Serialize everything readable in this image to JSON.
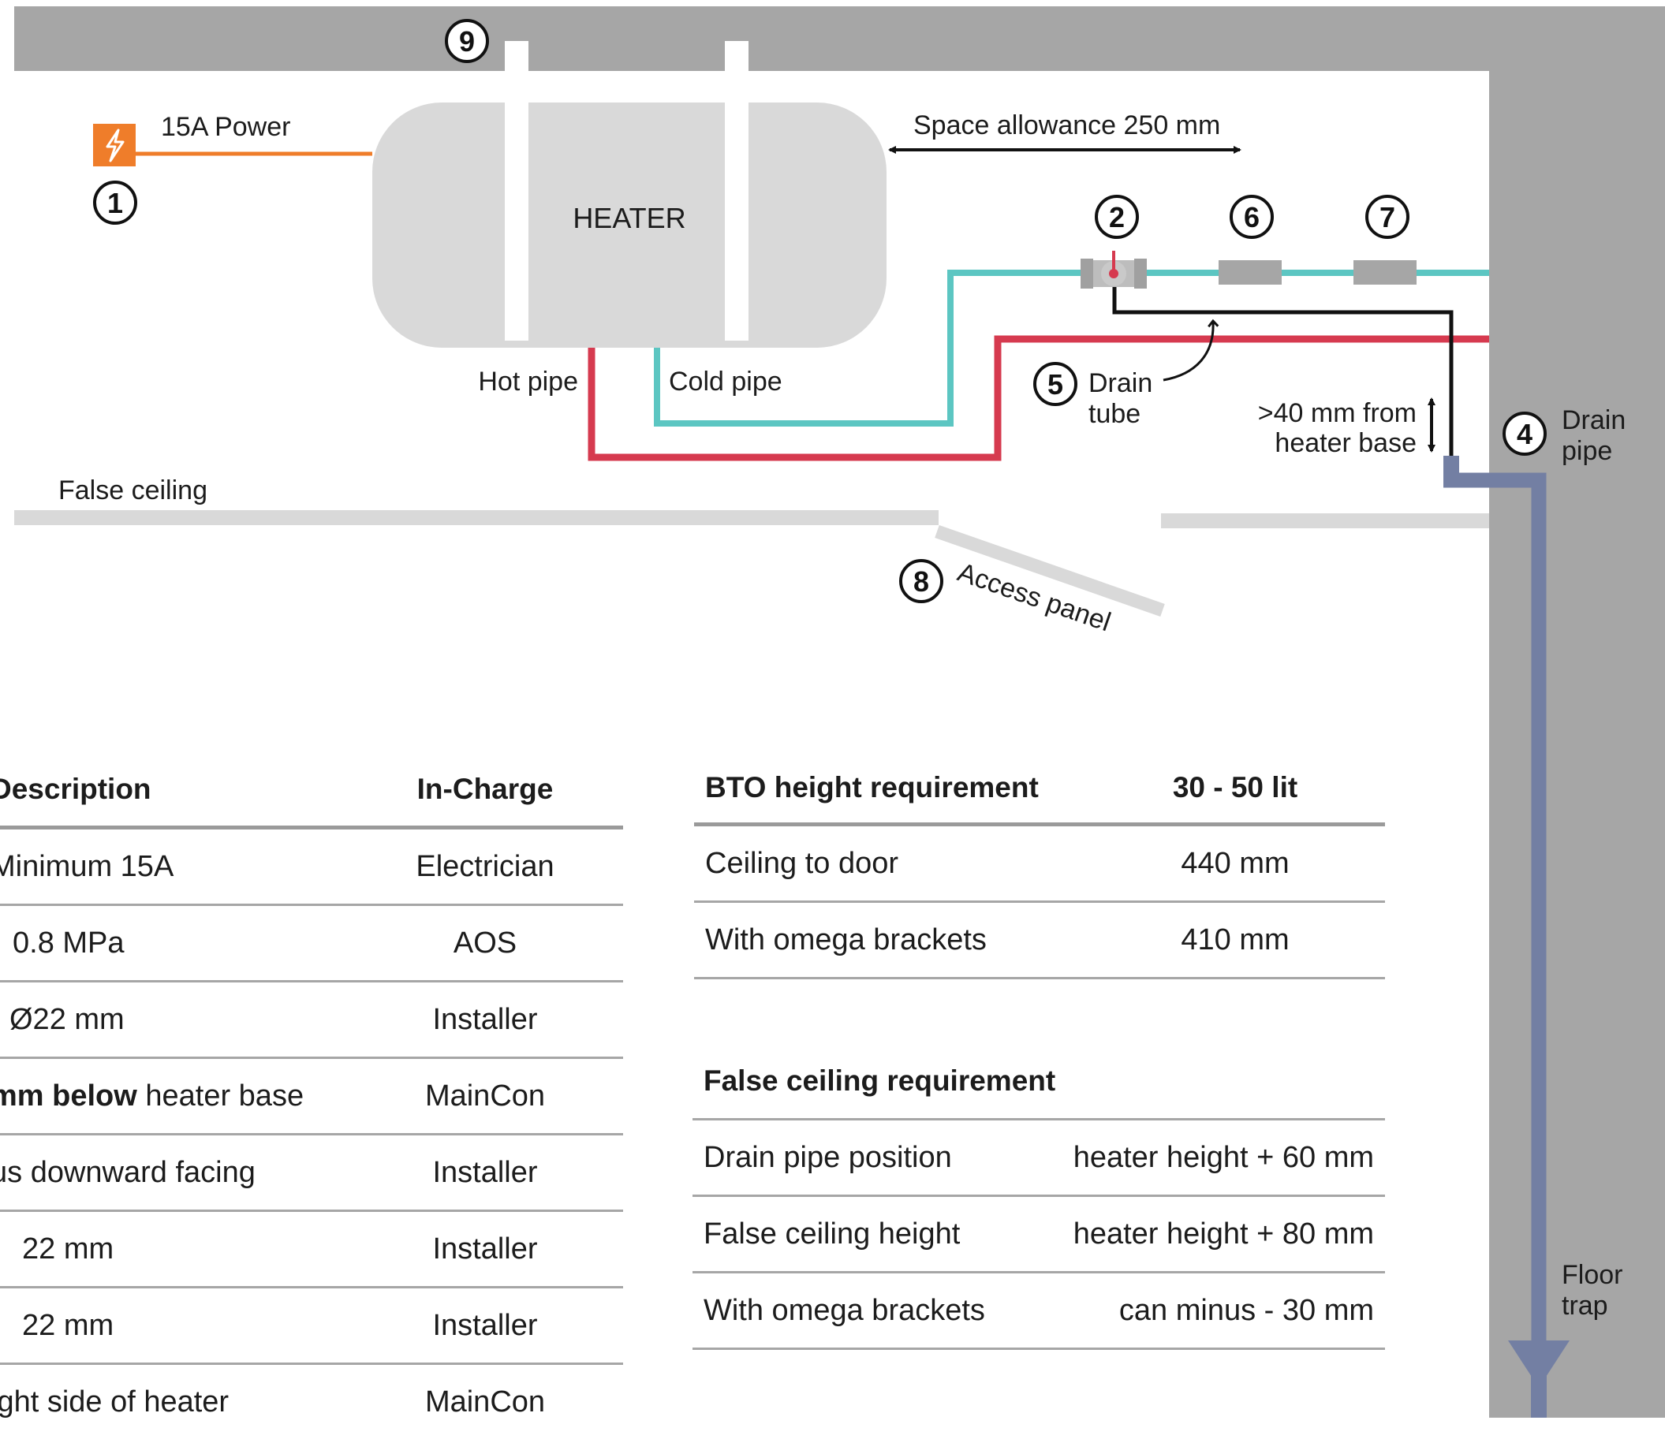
{
  "diagram": {
    "heater_label": "HEATER",
    "power_label": "15A Power",
    "space_label": "Space allowance 250 mm",
    "hot_pipe_label": "Hot pipe",
    "cold_pipe_label": "Cold pipe",
    "drain_tube_line1": "Drain",
    "drain_tube_line2": "tube",
    "height_note_line1": ">40 mm from",
    "height_note_line2": "heater base",
    "drain_pipe_line1": "Drain",
    "drain_pipe_line2": "pipe",
    "false_ceiling_label": "False ceiling",
    "access_panel_label": "Access panel",
    "floor_trap_line1": "Floor",
    "floor_trap_line2": "trap",
    "markers": [
      "1",
      "2",
      "4",
      "5",
      "6",
      "7",
      "8",
      "9"
    ],
    "colors": {
      "wall": "#a6a6a6",
      "heater": "#d9d9d9",
      "hot_pipe": "#d63a4f",
      "cold_pipe": "#5cc6c2",
      "power_line": "#ef7d2a",
      "drain_pipe": "#737fa3",
      "false_ceiling": "#d9d9d9"
    },
    "icons": [
      "power-bolt-icon",
      "valve-icon",
      "fitting-icon"
    ]
  },
  "desc_table": {
    "headers": [
      "Description",
      "In-Charge"
    ],
    "rows": [
      {
        "desc_bold": "",
        "desc": "Minimum 15A",
        "charge": "Electrician"
      },
      {
        "desc_bold": "",
        "desc": "0.8 MPa",
        "charge": "AOS"
      },
      {
        "desc_bold": "",
        "desc": "Ø22 mm",
        "charge": "Installer"
      },
      {
        "desc_bold": "mm below",
        "desc": " heater base",
        "charge": "MainCon"
      },
      {
        "desc_bold": "",
        "desc": "us downward facing",
        "charge": "Installer"
      },
      {
        "desc_bold": "",
        "desc": "22 mm",
        "charge": "Installer"
      },
      {
        "desc_bold": "",
        "desc": "22 mm",
        "charge": "Installer"
      },
      {
        "desc_bold": "",
        "desc": "ight side of heater",
        "charge": "MainCon"
      }
    ]
  },
  "bto_table": {
    "headers": [
      "BTO height requirement",
      "30 - 50 lit"
    ],
    "rows": [
      {
        "label": "Ceiling to door",
        "value": "440 mm"
      },
      {
        "label": "With omega brackets",
        "value": "410 mm"
      }
    ]
  },
  "false_ceiling_table": {
    "title": "False ceiling requirement",
    "rows": [
      {
        "label": "Drain pipe position",
        "value": "heater height + 60 mm"
      },
      {
        "label": "False ceiling height",
        "value": "heater height + 80 mm"
      },
      {
        "label": "With omega brackets",
        "value": "can minus - 30 mm"
      }
    ]
  }
}
